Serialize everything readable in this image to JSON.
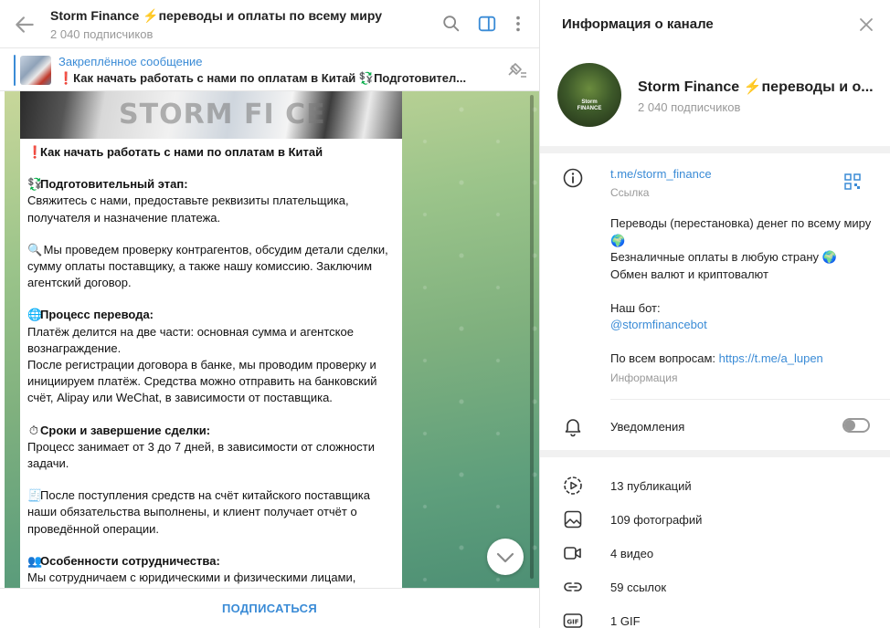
{
  "chat": {
    "title": "Storm Finance ⚡️переводы и оплаты по всему миру",
    "subtitle": "2 040 подписчиков",
    "pinned": {
      "label": "Закреплённое сообщение",
      "text": "❗️Как начать работать с нами по оплатам в Китай  💱Подготовител..."
    },
    "image_watermark": "STORM FI  CE",
    "message": {
      "heading": "Как начать работать с нами по оплатам в Китай",
      "heading_emoji": "❗️",
      "sections": [
        {
          "emoji": "💱",
          "title": "Подготовительный этап:",
          "text": "Свяжитесь с нами, предоставьте реквизиты плательщика, получателя и назначение платежа."
        },
        {
          "emoji": "🔍",
          "title": "",
          "text": "Мы проведем проверку контрагентов, обсудим детали сделки, сумму оплаты поставщику, а также нашу комиссию. Заключим агентский договор."
        },
        {
          "emoji": "🌐",
          "title": "Процесс перевода:",
          "text": "Платёж делится на две части: основная сумма и агентское вознаграждение.\nПосле регистрации договора в банке, мы проводим проверку и инициируем платёж. Средства можно отправить на банковский счёт, Alipay или WeChat, в зависимости от поставщика."
        },
        {
          "emoji": "⏱",
          "title": "Сроки и завершение сделки:",
          "text": "Процесс занимает от 3 до 7 дней, в зависимости от сложности задачи."
        },
        {
          "emoji": "🧾",
          "title": "",
          "text": "После поступления средств на счёт китайского поставщика наши обязательства выполнены, и клиент получает отчёт о проведённой операции."
        },
        {
          "emoji": "👥",
          "title": "Особенности сотрудничества:",
          "text": "Мы сотрудничаем с юридическими и физическими лицами, которые проходят наш внутренний комплаенс."
        }
      ]
    },
    "subscribe_label": "ПОДПИСАТЬСЯ"
  },
  "info": {
    "panel_title": "Информация о канале",
    "name": "Storm Finance ⚡️переводы и о...",
    "subscribers": "2 040 подписчиков",
    "avatar_text": "Storm\nFINANCE",
    "link": "t.me/storm_finance",
    "link_caption": "Ссылка",
    "description_lines": [
      "Переводы (перестановка) денег по всему миру 🌍",
      "Безналичные оплаты в любую страну 🌍",
      "Обмен валют и криптовалют"
    ],
    "bot_label": "Наш бот:",
    "bot_link": "@stormfinancebot",
    "questions_label": "По всем вопросам: ",
    "questions_link": "https://t.me/a_lupen",
    "description_caption": "Информация",
    "notifications_label": "Уведомления",
    "notifications_on": false,
    "media": [
      {
        "icon": "publications-icon",
        "label": "13 публикаций"
      },
      {
        "icon": "photo-icon",
        "label": "109 фотографий"
      },
      {
        "icon": "video-icon",
        "label": "4 видео"
      },
      {
        "icon": "link-icon",
        "label": "59 ссылок"
      },
      {
        "icon": "gif-icon",
        "label": "1 GIF"
      }
    ]
  },
  "colors": {
    "accent": "#3a8bd6",
    "muted": "#999999"
  }
}
